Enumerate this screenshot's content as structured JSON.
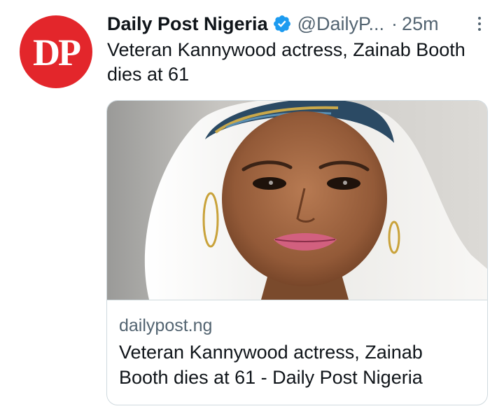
{
  "avatar": {
    "initials": "DP",
    "bg_color": "#e3262b"
  },
  "header": {
    "display_name": "Daily Post Nigeria",
    "verified_icon": "verified-badge-icon",
    "verified_color": "#1d9bf0",
    "handle": "@DailyP...",
    "separator": "·",
    "timestamp": "25m",
    "more_icon": "more-vertical-icon"
  },
  "tweet": {
    "text": "Veteran Kannywood actress, Zainab Booth dies at 61"
  },
  "card": {
    "image_alt": "Portrait of a smiling woman wearing a white headscarf",
    "domain": "dailypost.ng",
    "title": "Veteran Kannywood actress, Zainab Booth dies at 61 - Daily Post Nigeria"
  },
  "colors": {
    "primary_text": "#0f1419",
    "secondary_text": "#536471",
    "border": "#cfd9de"
  }
}
